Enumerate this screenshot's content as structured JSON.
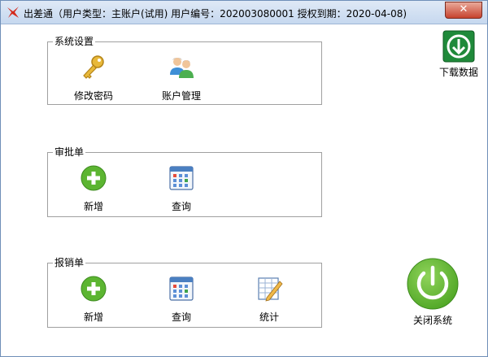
{
  "window": {
    "title": "出差通（用户类型：主账户(试用)  用户编号：202003080001  授权到期：2020-04-08)",
    "close_label": "✕"
  },
  "system_settings": {
    "title": "系统设置",
    "change_password": "修改密码",
    "account_management": "账户管理"
  },
  "approval": {
    "title": "审批单",
    "add": "新增",
    "query": "查询"
  },
  "reimbursement": {
    "title": "报销单",
    "add": "新增",
    "query": "查询",
    "statistics": "统计"
  },
  "download": {
    "label": "下载数据"
  },
  "shutdown": {
    "label": "关闭系统"
  },
  "colors": {
    "accent_green": "#5cb531",
    "dark_green": "#1f8a3a",
    "close_red": "#c7432e"
  },
  "icons": [
    "app-logo-icon",
    "key-icon",
    "users-icon",
    "plus-circle-icon",
    "calendar-icon",
    "chart-icon",
    "download-icon",
    "power-icon"
  ]
}
